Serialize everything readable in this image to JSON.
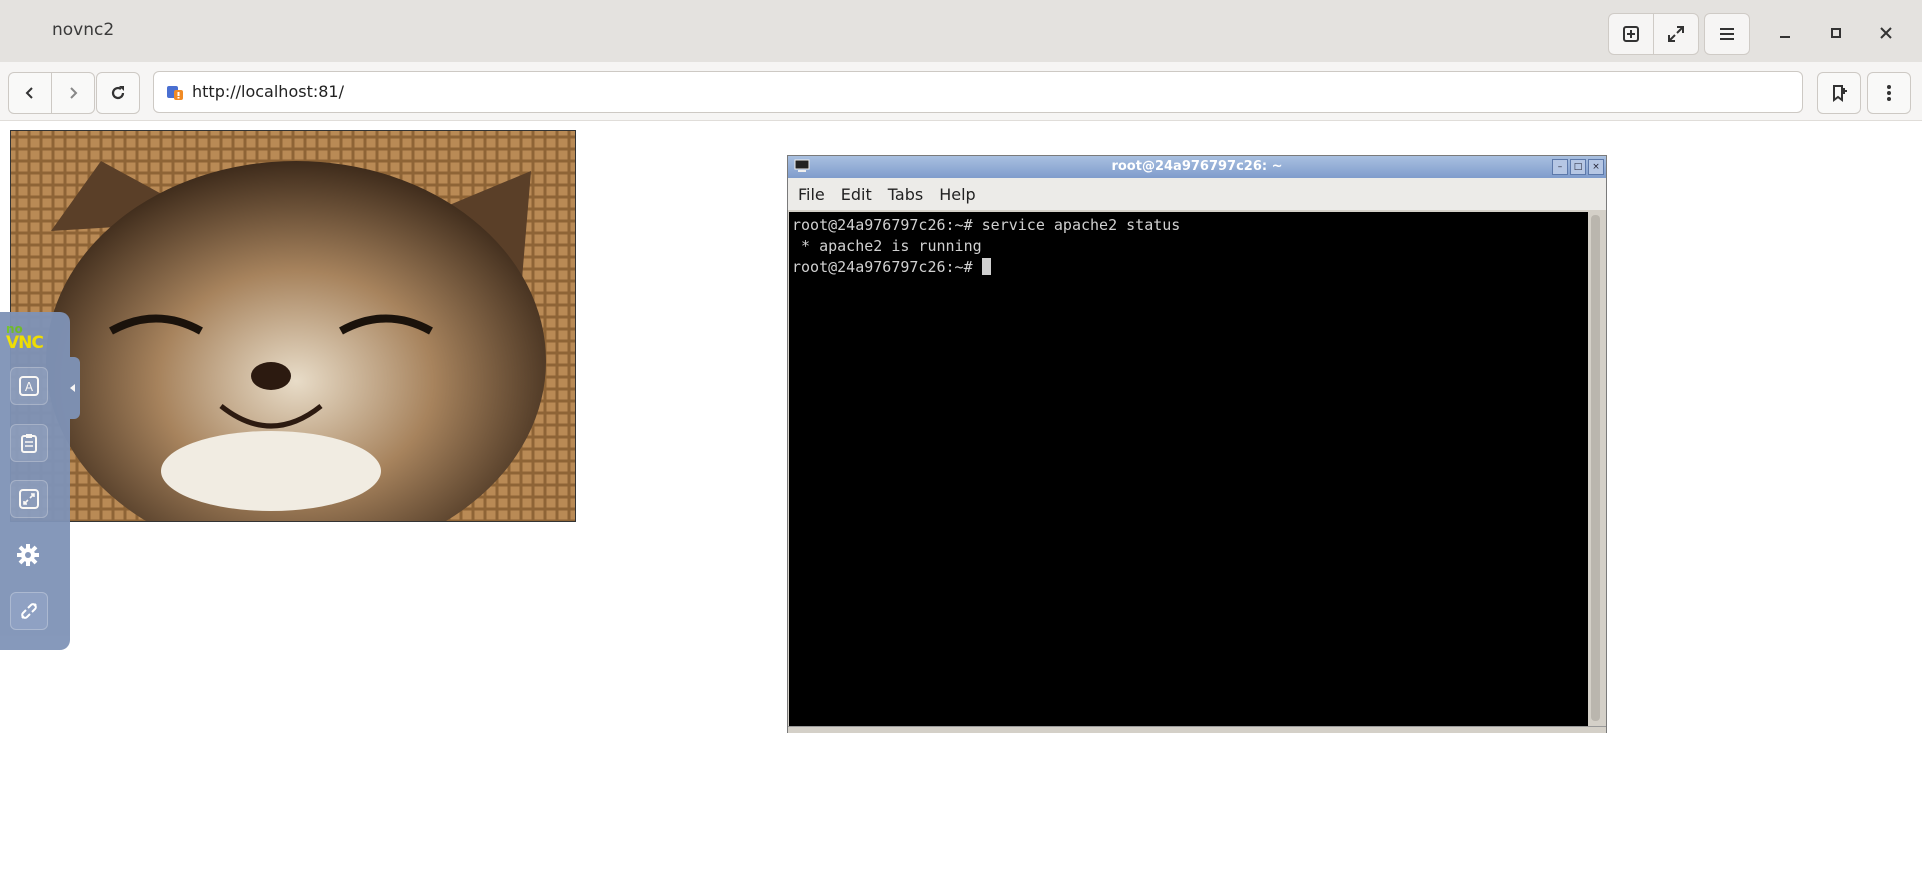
{
  "window": {
    "title": "novnc2",
    "controls": [
      "new-tab-icon",
      "fullscreen-icon",
      "menu-icon",
      "minimize-icon",
      "maximize-icon",
      "close-icon"
    ]
  },
  "navbar": {
    "url": "http://localhost:81/",
    "buttons": [
      "back-icon",
      "forward-icon",
      "reload-icon",
      "bookmark-icon",
      "more-icon"
    ]
  },
  "novnc_panel": {
    "logo_no": "no",
    "logo_vnc": "VNC",
    "buttons": [
      "keyboard-icon",
      "clipboard-icon",
      "fullscreen-icon",
      "settings-icon",
      "disconnect-icon"
    ]
  },
  "terminal": {
    "title": "root@24a976797c26: ~",
    "menu": [
      "File",
      "Edit",
      "Tabs",
      "Help"
    ],
    "lines": [
      "root@24a976797c26:~# service apache2 status",
      " * apache2 is running",
      "root@24a976797c26:~# "
    ]
  },
  "colors": {
    "terminal_bg": "#000000",
    "terminal_fg": "#d0d0d0",
    "novnc_panel": "#7f93b7",
    "term_titlebar": "#8aa6d2"
  }
}
